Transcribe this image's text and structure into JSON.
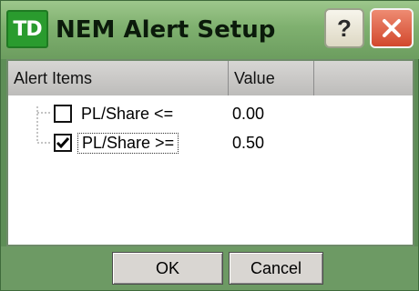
{
  "window": {
    "logo_text": "TD",
    "title": "NEM Alert Setup",
    "help_label": "?",
    "accent_color": "#5e8e57",
    "close_color": "#d2482d"
  },
  "table": {
    "headers": [
      "Alert Items",
      "Value",
      ""
    ],
    "rows": [
      {
        "label": "PL/Share <=",
        "value": "0.00",
        "checked": false
      },
      {
        "label": "PL/Share >=",
        "value": "0.50",
        "checked": true
      }
    ]
  },
  "footer": {
    "ok_label": "OK",
    "cancel_label": "Cancel"
  },
  "icons": {
    "help": "help-icon",
    "close": "close-icon",
    "logo": "td-logo-icon"
  }
}
